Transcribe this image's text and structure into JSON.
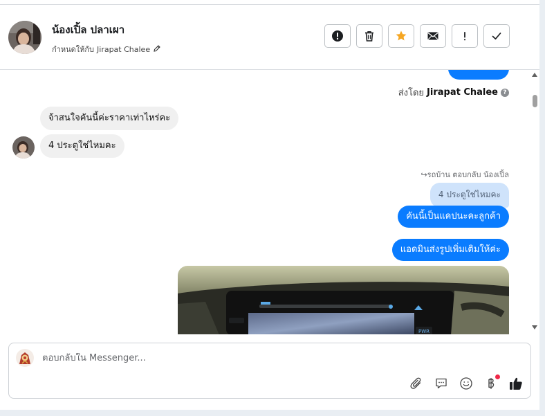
{
  "header": {
    "contact_name": "น้องเปิ้ล ปลาเผา",
    "assign_label": "กำหนดให้กับ",
    "assignee": "Jirapat Chalee"
  },
  "actions": [
    {
      "icon": "exclamation-circle-icon"
    },
    {
      "icon": "trash-icon"
    },
    {
      "icon": "star-icon",
      "color": "#f5a623"
    },
    {
      "icon": "envelope-icon"
    },
    {
      "icon": "exclamation-mark-icon"
    },
    {
      "icon": "checkmark-icon"
    }
  ],
  "messages": {
    "sent_by_label": "ส่งโดย",
    "sent_by_name": "Jirapat Chalee",
    "incoming": [
      {
        "text": "จ้าสนใจคันนี้ค่ะราคาเท่าไหร่คะ"
      },
      {
        "text": "4 ประตูใช่ไหมคะ"
      }
    ],
    "reply_meta": "↪รถบ้าน ตอบกลับ น้องเปิ้ล",
    "quoted_text": "4 ประตูใช่ไหมคะ",
    "outgoing": [
      {
        "text": "คันนี้เป็นแคปนะคะลูกค้า"
      },
      {
        "text": "แอดมินส่งรูปเพิ่มเติมให้ค่ะ"
      }
    ],
    "photo_label": "PWR"
  },
  "composer": {
    "placeholder": "ตอบกลับใน Messenger..."
  },
  "colors": {
    "accent": "#0a7cff",
    "star": "#f5a623",
    "notification": "#f02849"
  }
}
